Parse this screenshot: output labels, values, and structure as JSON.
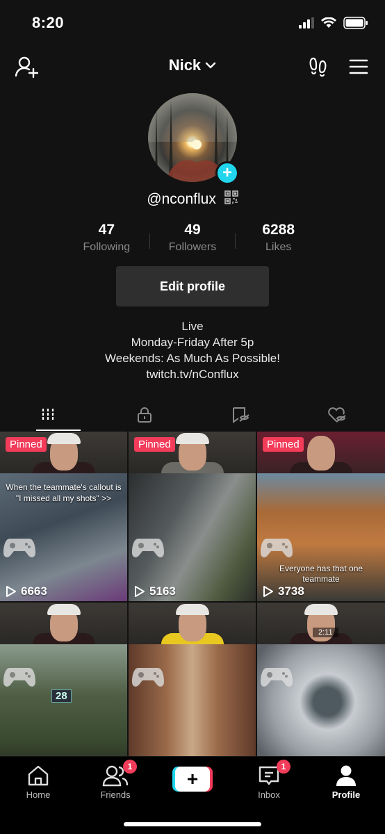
{
  "status": {
    "time": "8:20"
  },
  "header": {
    "username": "Nick"
  },
  "profile": {
    "handle": "@nconflux",
    "stats": [
      {
        "value": "47",
        "label": "Following"
      },
      {
        "value": "49",
        "label": "Followers"
      },
      {
        "value": "6288",
        "label": "Likes"
      }
    ],
    "edit_label": "Edit profile",
    "bio": [
      "Live",
      "Monday-Friday After 5p",
      "Weekends: As Much As Possible!",
      "twitch.tv/nConflux"
    ]
  },
  "videos": [
    {
      "pinned_label": "Pinned",
      "plays": "6663",
      "caption": "When the teammate's callout is \"I missed all my shots\" >>"
    },
    {
      "pinned_label": "Pinned",
      "plays": "5163"
    },
    {
      "pinned_label": "Pinned",
      "plays": "3738",
      "caption": "Everyone has that one teammate"
    },
    {
      "hud": "28"
    },
    {},
    {
      "hud_time": "2:11"
    }
  ],
  "nav": {
    "home": "Home",
    "friends": "Friends",
    "friends_badge": "1",
    "inbox": "Inbox",
    "inbox_badge": "1",
    "profile": "Profile"
  },
  "colors": {
    "accent": "#f23c5a",
    "cyan": "#20d5ec",
    "background": "#121212"
  }
}
